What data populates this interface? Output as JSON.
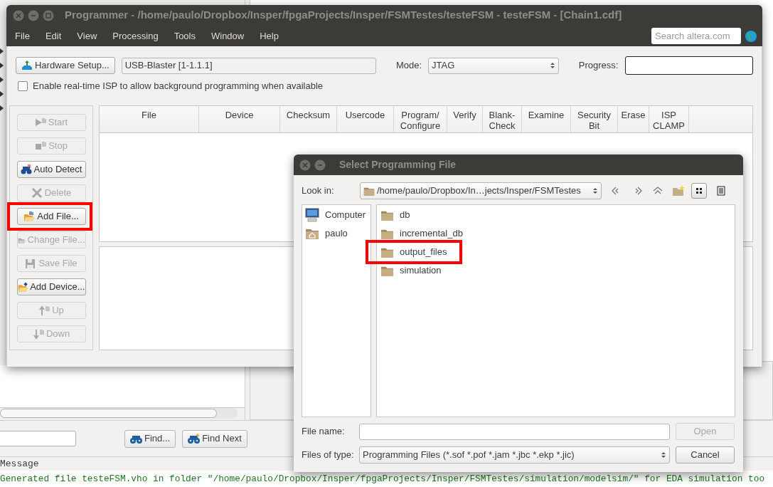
{
  "background_window": {
    "find_buttons": [
      {
        "kind": "find",
        "label": "Find..."
      },
      {
        "kind": "find_next",
        "label": "Find Next"
      }
    ],
    "messages_header": "Message",
    "message_line": "Generated file testeFSM.vho in folder \"/home/paulo/Dropbox/Insper/fpgaProjects/Insper/FSMTestes/simulation/modelsim/\" for EDA simulation too"
  },
  "programmer": {
    "title": "Programmer - /home/paulo/Dropbox/Insper/fpgaProjects/Insper/FSMTestes/testeFSM - testeFSM - [Chain1.cdf]",
    "menu": [
      "File",
      "Edit",
      "View",
      "Processing",
      "Tools",
      "Window",
      "Help"
    ],
    "search": {
      "placeholder": "Search altera.com"
    },
    "hardware_button": "Hardware Setup...",
    "hardware_field": "USB-Blaster [1-1.1.1]",
    "mode_label": "Mode:",
    "mode_value": "JTAG",
    "progress_label": "Progress:",
    "progress": {
      "level": 0
    },
    "realtime_isp": {
      "label": "Enable real-time ISP to allow background programming when available",
      "checked": false
    },
    "side_buttons": [
      {
        "label": "Start",
        "kind": "start",
        "disabled": true,
        "highlighted": false
      },
      {
        "label": "Stop",
        "kind": "stop",
        "disabled": true,
        "highlighted": false
      },
      {
        "label": "Auto Detect",
        "kind": "detect",
        "disabled": false,
        "highlighted": false
      },
      {
        "label": "Delete",
        "kind": "delete",
        "disabled": true,
        "highlighted": false
      },
      {
        "label": "Add File...",
        "kind": "add_file",
        "disabled": false,
        "highlighted": true
      },
      {
        "label": "Change File...",
        "kind": "change_file",
        "disabled": true,
        "highlighted": false
      },
      {
        "label": "Save File",
        "kind": "save",
        "disabled": true,
        "highlighted": false
      },
      {
        "label": "Add Device...",
        "kind": "add_device",
        "disabled": false,
        "highlighted": false
      },
      {
        "label": "Up",
        "kind": "up",
        "disabled": true,
        "highlighted": false
      },
      {
        "label": "Down",
        "kind": "down",
        "disabled": true,
        "highlighted": false
      }
    ],
    "columns": [
      "File",
      "Device",
      "Checksum",
      "Usercode",
      "Program/\nConfigure",
      "Verify",
      "Blank-\nCheck",
      "Examine",
      "Security\nBit",
      "Erase",
      "ISP\nCLAMP"
    ]
  },
  "dialog": {
    "title": "Select Programming File",
    "look_in_label": "Look in:",
    "path": "/home/paulo/Dropbox/In…jects/Insper/FSMTestes",
    "view_modes": [
      {
        "kind": "icons",
        "selected": true
      },
      {
        "kind": "details",
        "selected": false
      }
    ],
    "places": [
      {
        "label": "Computer",
        "kind": "computer"
      },
      {
        "label": "paulo",
        "kind": "home"
      }
    ],
    "files": [
      {
        "label": "db",
        "highlighted": false
      },
      {
        "label": "incremental_db",
        "highlighted": false
      },
      {
        "label": "output_files",
        "highlighted": true
      },
      {
        "label": "simulation",
        "highlighted": false
      }
    ],
    "file_name_label": "File name:",
    "open_button": {
      "label": "Open",
      "disabled": true
    },
    "file_type_label": "Files of type:",
    "file_type": "Programming Files (*.sof *.pof *.jam *.jbc *.ekp *.jic)",
    "cancel_button": "Cancel"
  }
}
